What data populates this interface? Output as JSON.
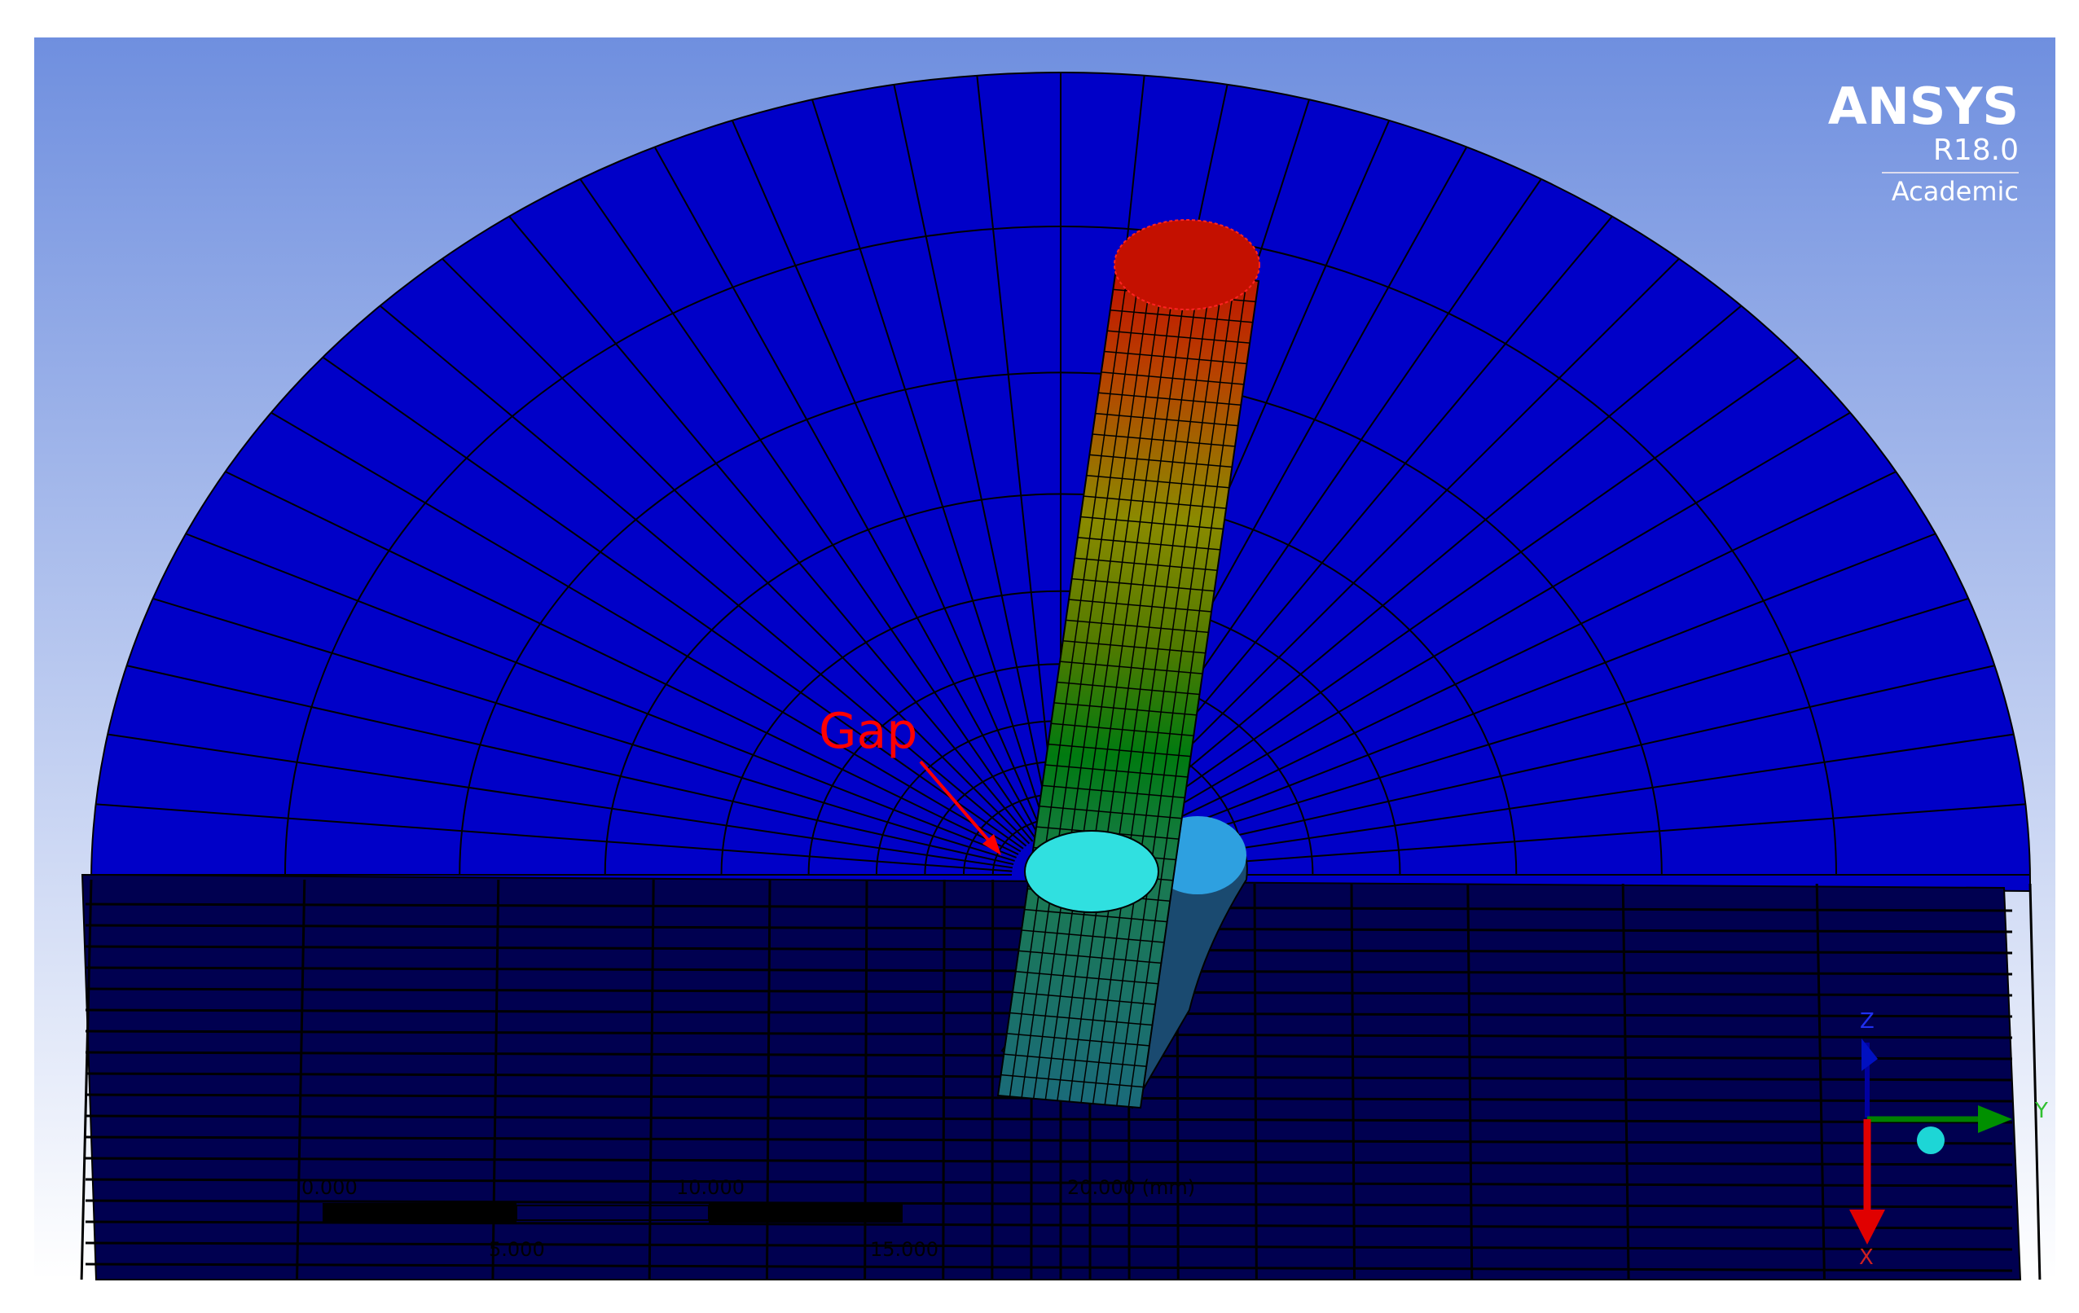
{
  "logo": {
    "brand": "ANSYS",
    "version": "R18.0",
    "edition": "Academic"
  },
  "annotation": {
    "label": "Gap"
  },
  "scale_bar": {
    "labels_top": [
      "0.000",
      "10.000",
      "20.000 (mm)"
    ],
    "labels_bottom": [
      "5.000",
      "15.000"
    ]
  },
  "triad": {
    "x_label": "X",
    "y_label": "Y",
    "z_label": "Z"
  },
  "colors": {
    "background_top": "#6f8fdf",
    "background_bottom": "#ffffff",
    "domain_upper": "#0000c8",
    "domain_lower": "#000050",
    "annotation": "#ff0000"
  }
}
